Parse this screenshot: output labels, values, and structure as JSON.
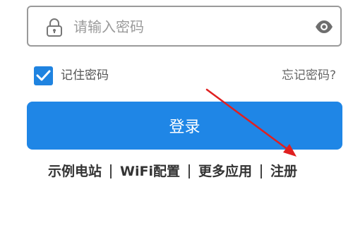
{
  "password_field": {
    "placeholder": "请输入密码",
    "value": "",
    "lock_icon": "lock-icon",
    "visibility_icon": "eye-icon"
  },
  "remember": {
    "checked": true,
    "label": "记住密码",
    "forgot_label": "忘记密码?"
  },
  "login_button": {
    "label": "登录"
  },
  "links": [
    {
      "label": "示例电站"
    },
    {
      "label": "WiFi配置"
    },
    {
      "label": "更多应用"
    },
    {
      "label": "注册"
    }
  ],
  "annotation": {
    "icon": "red-arrow-pointing-to-register",
    "color": "#e02020"
  },
  "colors": {
    "accent": "#1f86e6",
    "border": "#9a9a9a"
  }
}
